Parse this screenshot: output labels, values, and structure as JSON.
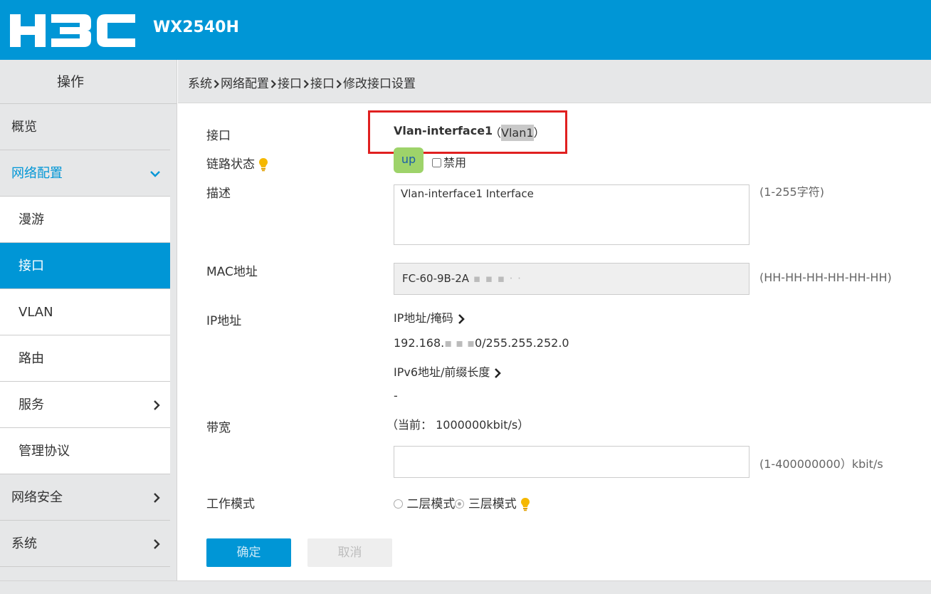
{
  "header": {
    "brand": "H3C",
    "model": "WX2540H",
    "brand_color": "#0096d6"
  },
  "sidebar": {
    "title": "操作",
    "items": [
      {
        "label": "概览",
        "level": "top",
        "state": "normal",
        "chevron": "none"
      },
      {
        "label": "网络配置",
        "level": "top",
        "state": "open",
        "chevron": "down"
      },
      {
        "label": "漫游",
        "level": "sub",
        "state": "normal",
        "chevron": "none"
      },
      {
        "label": "接口",
        "level": "sub",
        "state": "active",
        "chevron": "none"
      },
      {
        "label": "VLAN",
        "level": "sub",
        "state": "normal",
        "chevron": "none"
      },
      {
        "label": "路由",
        "level": "sub",
        "state": "normal",
        "chevron": "none"
      },
      {
        "label": "服务",
        "level": "sub",
        "state": "normal",
        "chevron": "right"
      },
      {
        "label": "管理协议",
        "level": "sub",
        "state": "normal",
        "chevron": "none"
      },
      {
        "label": "网络安全",
        "level": "top",
        "state": "normal",
        "chevron": "right"
      },
      {
        "label": "系统",
        "level": "top",
        "state": "normal",
        "chevron": "right"
      }
    ]
  },
  "breadcrumb": [
    "系统",
    "网络配置",
    "接口",
    "接口",
    "修改接口设置"
  ],
  "form": {
    "interface_label": "接口",
    "interface_name": "Vlan-interface1",
    "vlan_open": "（",
    "vlan_name": "Vlan1",
    "vlan_close": "）",
    "link_state_label": "链路状态",
    "link_state_value": "up",
    "disable_label": "禁用",
    "description_label": "描述",
    "description_value": "Vlan-interface1 Interface",
    "description_hint": "(1-255字符)",
    "mac_label": "MAC地址",
    "mac_value": "FC-60-9B-2A",
    "mac_hint": "(HH-HH-HH-HH-HH-HH)",
    "ip_label": "IP地址",
    "ip_mask_link": "IP地址/掩码",
    "ip_value_prefix": "192.168.",
    "ip_value_suffix": "0/255.255.252.0",
    "ipv6_link": "IPv6地址/前缀长度",
    "ipv6_value": "-",
    "bandwidth_label": "带宽",
    "bandwidth_current": "（当前： 1000000kbit/s）",
    "bandwidth_hint": "(1-400000000）kbit/s",
    "work_mode_label": "工作模式",
    "mode_layer2": "二层模式",
    "mode_layer3": "三层模式",
    "selected_mode": "三层模式"
  },
  "buttons": {
    "ok": "确定",
    "cancel": "取消"
  }
}
